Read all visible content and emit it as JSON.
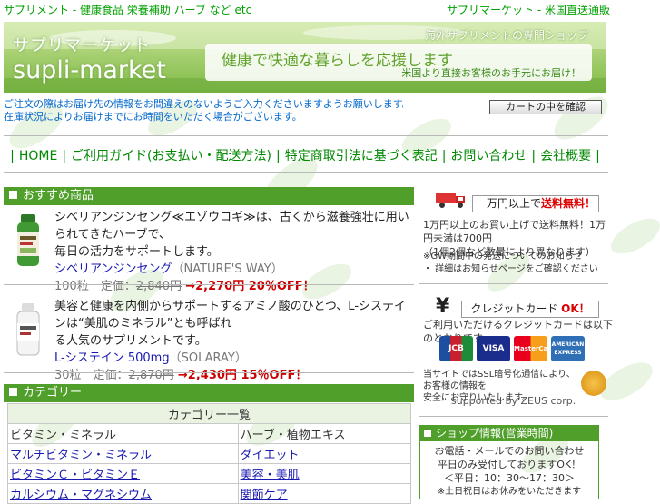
{
  "topbar": {
    "left": "サプリメント - 健康食品 栄養補助 ハーブ など etc",
    "right": "サプリマーケット - 米国直送通販"
  },
  "banner": {
    "jp_title": "サプリマーケット",
    "en_title": "supli-market",
    "tagline": "海外サプリメントの専門ショップ",
    "slogan": "健康で快適な暮らしを応援します",
    "slogan_sub": "米国より直接お客様のお手元にお届け！"
  },
  "notices": [
    "ご注文の際はお届け先の情報をお間違えのないようご入力くださいますようお願いします。",
    "在庫状況によりお届けまでにお時間をいただく場合がございます。"
  ],
  "cart_button": "カートの中を確認",
  "nav": {
    "items": [
      "HOME",
      "ご利用ガイド(お支払い・配送方法)",
      "特定商取引法に基づく表記",
      "お問い合わせ",
      "会社概要"
    ]
  },
  "sections": {
    "recommend": "おすすめ商品",
    "category": "カテゴリー"
  },
  "products": [
    {
      "title_line1": "シベリアンジンセング≪エゾウコギ≫は、古くから滋養強壮に用いられてきたハーブで、",
      "title_line2": "毎日の活力をサポートします。",
      "brand_name": "シベリアンジンセング",
      "brand_maker": "（NATURE'S WAY）",
      "count": "100粒　定価：",
      "old_price": "2,840円",
      "new_price": "→2,270円 20％OFF！"
    },
    {
      "title_line1": "美容と健康を内側からサポートするアミノ酸のひとつ、L-システインは“美肌のミネラル”とも呼ばれ",
      "title_line2": "る人気のサプリメントです。",
      "brand_name": "L-システイン",
      "brand_dose": " 500mg",
      "brand_maker": "（SOLARAY）",
      "count": "30粒　定価：",
      "old_price": "2,870円",
      "new_price": "→2,430円 15％OFF！"
    }
  ],
  "category_table": {
    "header": "カテゴリー一覧",
    "subheaders": [
      "ビタミン・ミネラル",
      "ハーブ・植物エキス"
    ],
    "rows": [
      [
        "マルチビタミン・ミネラル",
        "ダイエット"
      ],
      [
        "ビタミンＣ・ビタミンＥ",
        "美容・美肌"
      ],
      [
        "カルシウム・マグネシウム",
        "関節ケア"
      ]
    ]
  },
  "shipping": {
    "banner_text": "一万円以上で",
    "banner_red": "送料無料！",
    "line1": "1万円以上のお買い上げで送料無料！1万円未満は700円",
    "line2": "（1個2個など数量により異なります）",
    "gw1": "※GW期間中の発送についてのお知らせ",
    "gw2": "・ 詳細はお知らせページをご確認ください"
  },
  "credit": {
    "label": "クレジットカード",
    "ok": "OK！",
    "desc": "ご利用いただけるクレジットカードは以下のとおりです。",
    "cards": [
      "JCB",
      "VISA",
      "MasterCard",
      "AMERICAN EXPRESS"
    ],
    "ssl1": "当サイトではSSL暗号化通信により、お客様の情報を",
    "ssl2": "安全にお守りいたします。",
    "supported": "supported by ZEUS corp."
  },
  "shop": {
    "header": "ショップ情報(営業時間)",
    "line1": "お電話・メールでのお問い合わせ",
    "line2": "平日のみ受付しておりますOK！",
    "line3": "＜平日：10：30～17：30＞",
    "line4": "※土日祝日はお休みをいただきます"
  },
  "colors": {
    "accent_green": "#4f9f2a",
    "nav_green": "#008800",
    "link_blue": "#1a1ab0",
    "price_red": "#cc0000"
  }
}
